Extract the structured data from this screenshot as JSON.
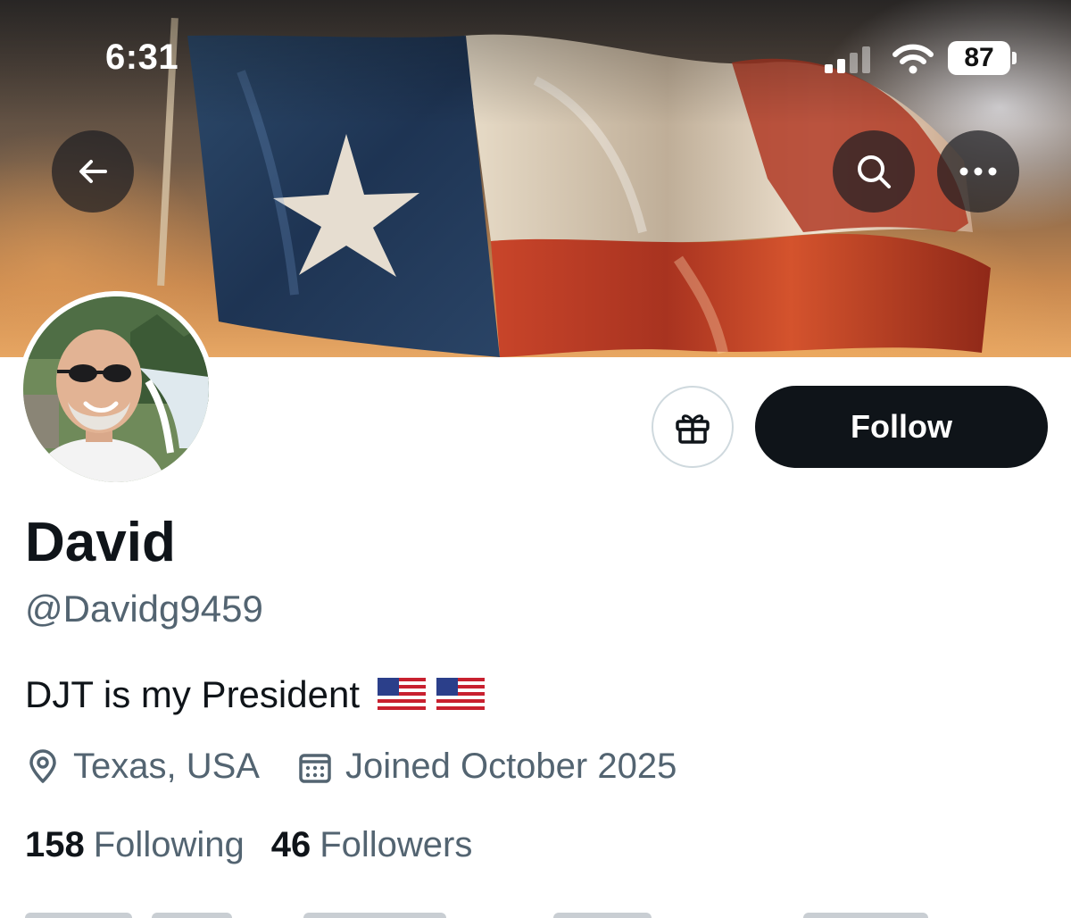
{
  "status_bar": {
    "time": "6:31",
    "battery": "87"
  },
  "top_bar": {
    "back_icon": "arrow-left-icon",
    "search_icon": "search-icon",
    "more_icon": "more-horizontal-icon"
  },
  "banner": {
    "description_icon": "texas-flag-banner"
  },
  "actions": {
    "gift_icon": "gift-icon",
    "follow_label": "Follow"
  },
  "profile": {
    "name": "David",
    "handle": "@Davidg9459",
    "bio": "DJT is my President",
    "location": "Texas, USA",
    "joined": "Joined October 2025",
    "following_count": "158",
    "following_label": "Following",
    "followers_count": "46",
    "followers_label": "Followers"
  },
  "colors": {
    "primary_text": "#0f1419",
    "secondary_text": "#536471",
    "follow_button_bg": "#0f1419",
    "border": "#cfd9de"
  }
}
